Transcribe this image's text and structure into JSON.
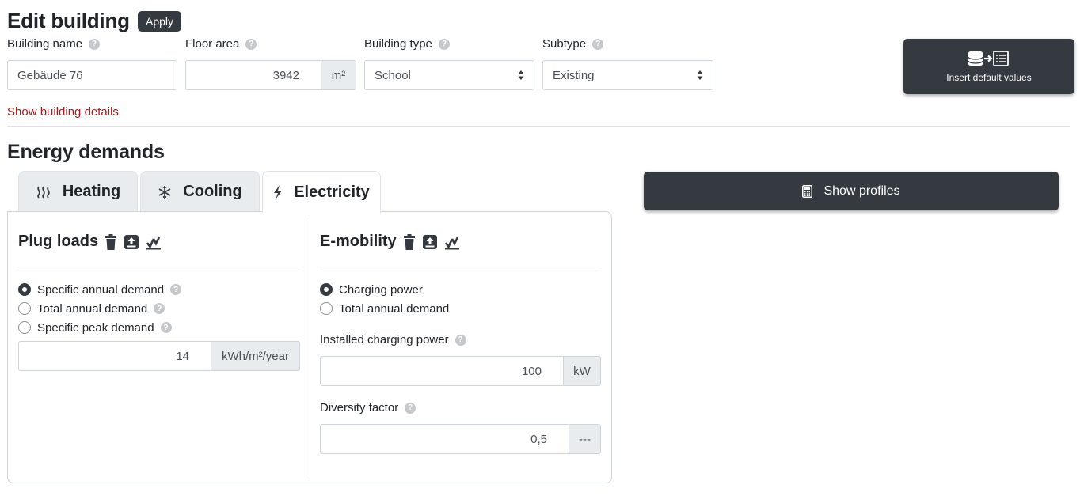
{
  "header": {
    "title": "Edit building",
    "apply_label": "Apply"
  },
  "fields": {
    "building_name": {
      "label": "Building name",
      "value": "Gebäude 76"
    },
    "floor_area": {
      "label": "Floor area",
      "value": "3942",
      "unit": "m²"
    },
    "building_type": {
      "label": "Building type",
      "value": "School"
    },
    "subtype": {
      "label": "Subtype",
      "value": "Existing"
    }
  },
  "insert_defaults": {
    "label": "Insert default values"
  },
  "show_details": "Show building details",
  "energy": {
    "title": "Energy demands",
    "tabs": [
      {
        "label": "Heating",
        "icon": "heat-waves-icon",
        "active": false
      },
      {
        "label": "Cooling",
        "icon": "snowflake-icon",
        "active": false
      },
      {
        "label": "Electricity",
        "icon": "lightning-icon",
        "active": true
      }
    ],
    "show_profiles": "Show profiles"
  },
  "plug_loads": {
    "title": "Plug loads",
    "options": [
      "Specific annual demand",
      "Total annual demand",
      "Specific peak demand"
    ],
    "selected": 0,
    "value": "14",
    "unit": "kWh/m²/year"
  },
  "emobility": {
    "title": "E-mobility",
    "options": [
      "Charging power",
      "Total annual demand"
    ],
    "selected": 0,
    "installed_label": "Installed charging power",
    "installed_value": "100",
    "installed_unit": "kW",
    "diversity_label": "Diversity factor",
    "diversity_value": "0,5",
    "diversity_unit": "---"
  },
  "colors": {
    "dark": "#343a40",
    "link": "#9b1c1c",
    "border": "#ced4da",
    "addon": "#e9ecef"
  }
}
